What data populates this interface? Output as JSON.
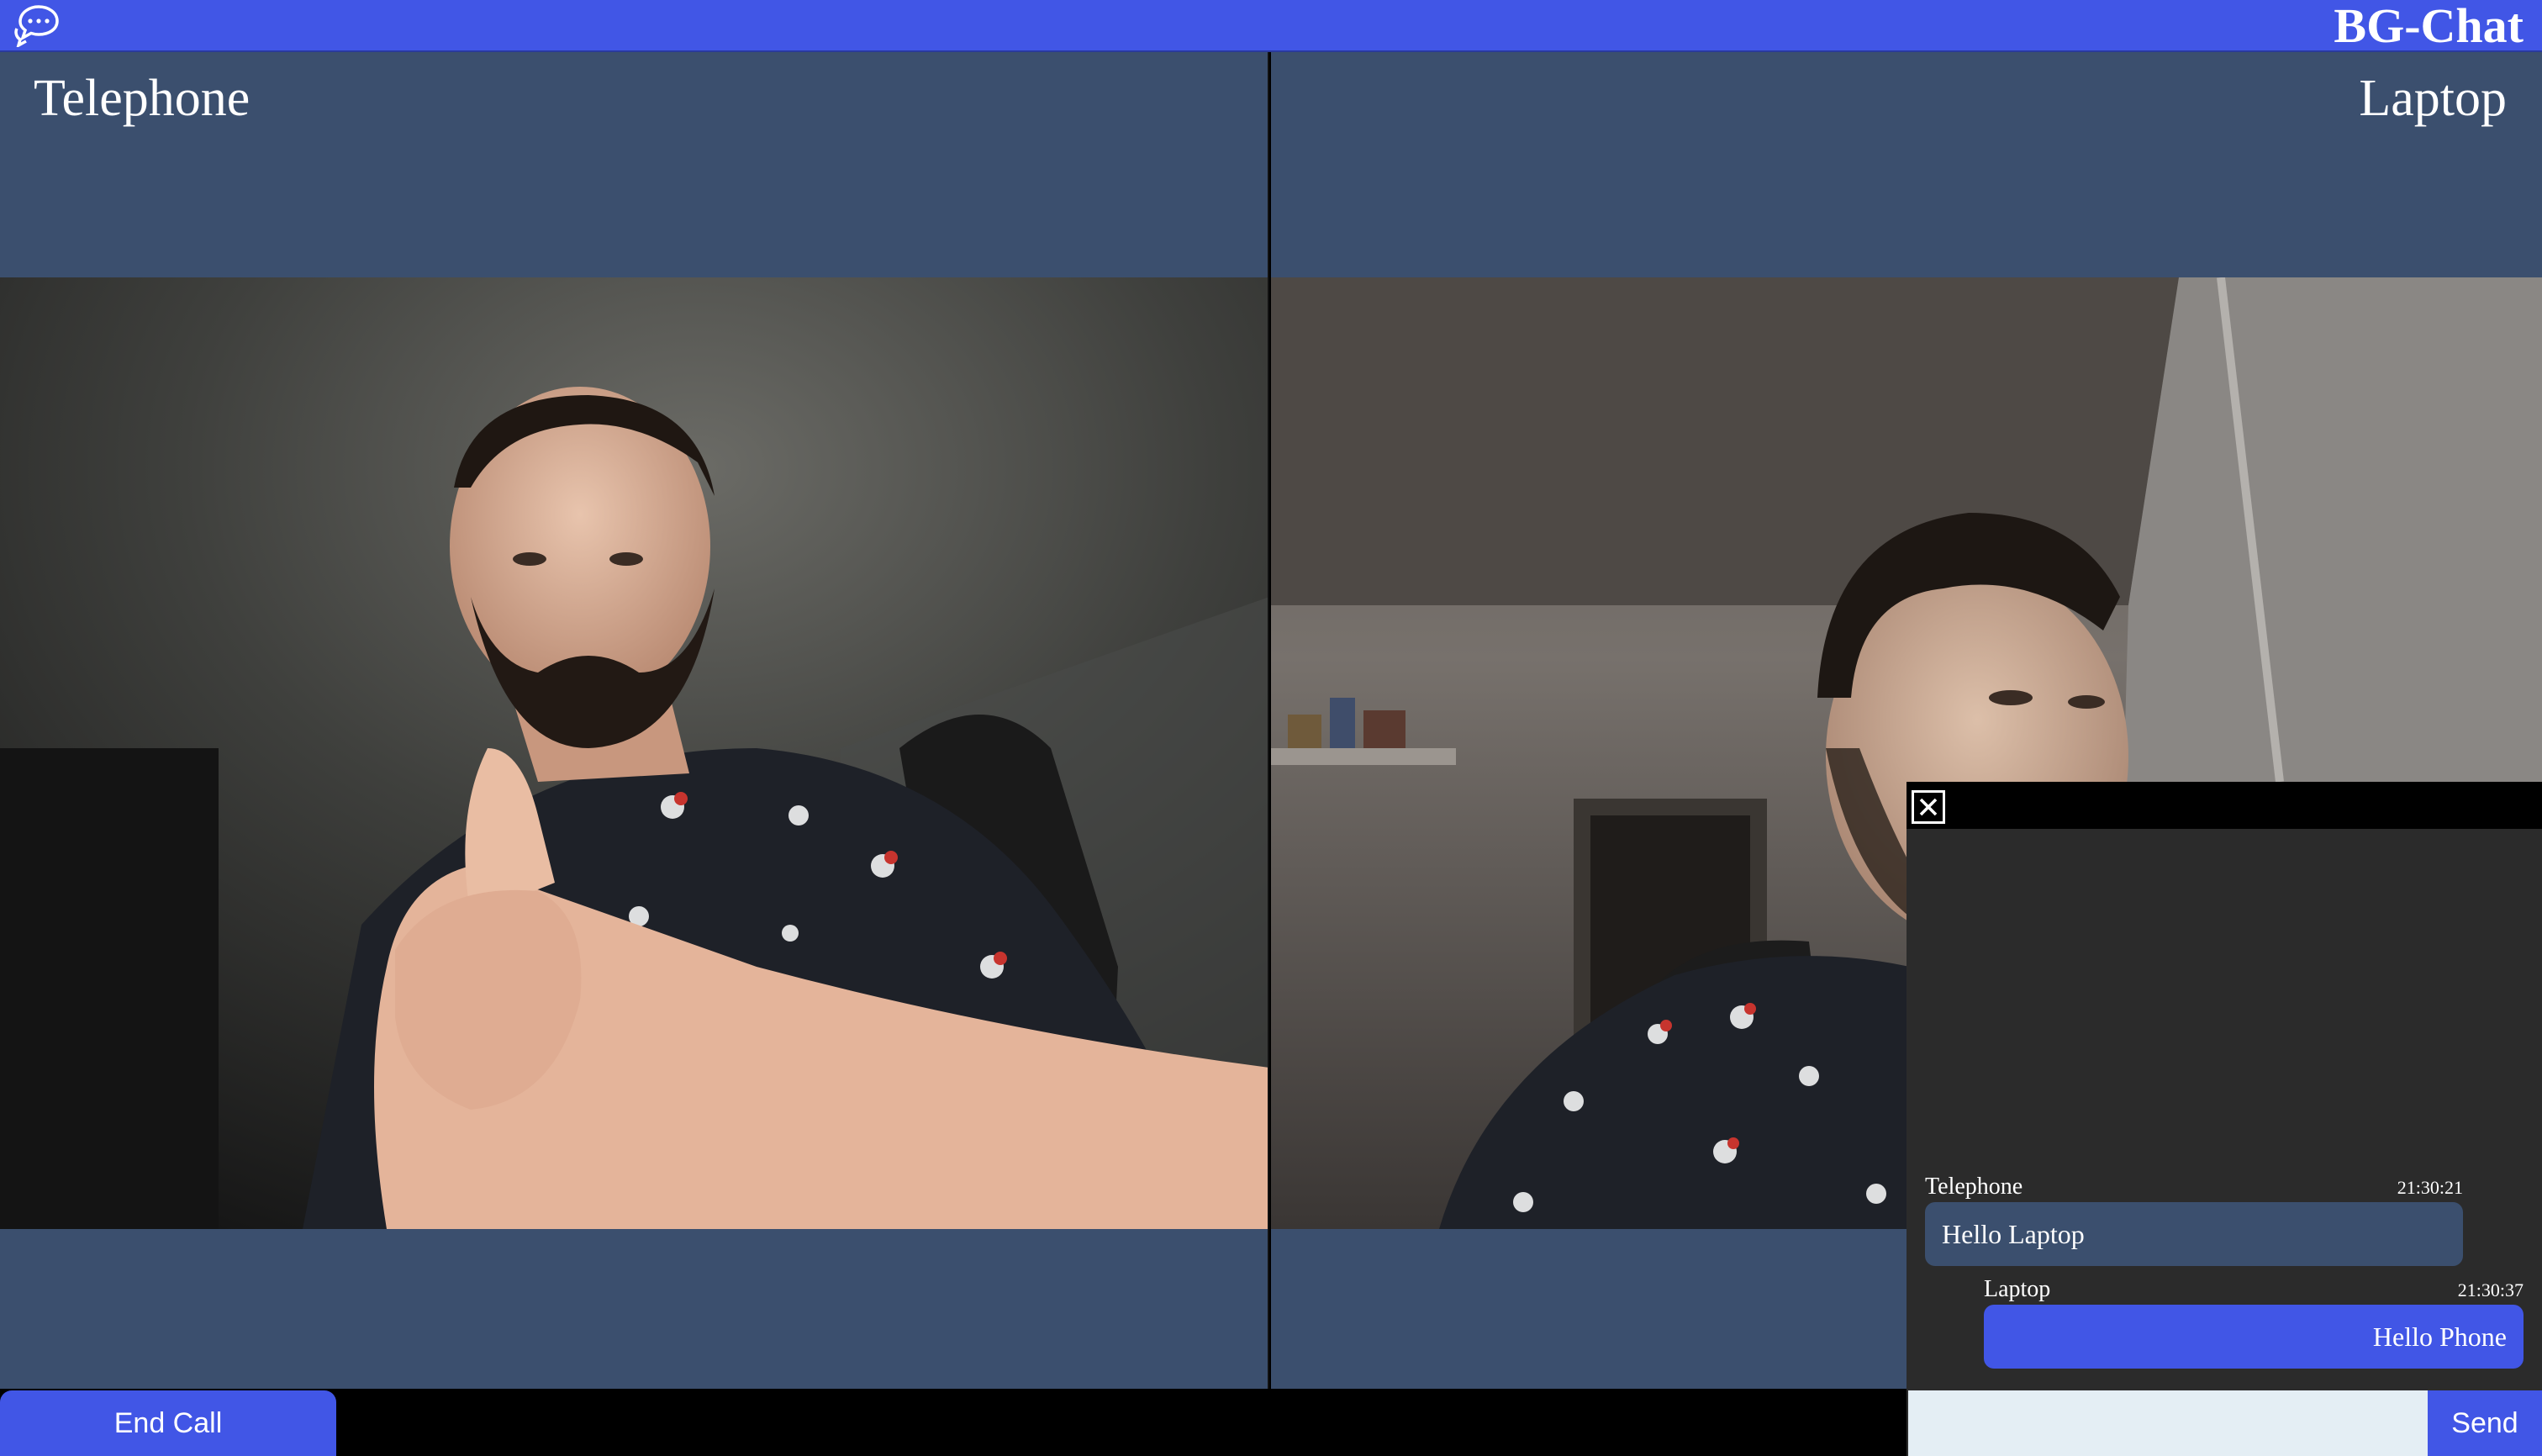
{
  "app": {
    "brand": "BG-Chat",
    "brand_color": "#4156e6",
    "icons": {
      "logo": "chat-bubbles-icon",
      "close": "close-icon"
    }
  },
  "participants": [
    {
      "label": "Telephone",
      "video": "remote-camera-feed"
    },
    {
      "label": "Laptop",
      "video": "local-camera-feed"
    }
  ],
  "controls": {
    "end_call_label": "End Call"
  },
  "chat": {
    "messages": [
      {
        "sender": "Telephone",
        "time": "21:30:21",
        "text": "Hello Laptop",
        "direction": "incoming"
      },
      {
        "sender": "Laptop",
        "time": "21:30:37",
        "text": "Hello Phone",
        "direction": "outgoing"
      }
    ],
    "input_value": "",
    "input_placeholder": "",
    "send_label": "Send"
  },
  "colors": {
    "pane_bg": "#3b4f6e",
    "chat_bg": "#2b2b2b",
    "incoming_bubble": "#3b4f6e",
    "outgoing_bubble": "#4156e6"
  }
}
